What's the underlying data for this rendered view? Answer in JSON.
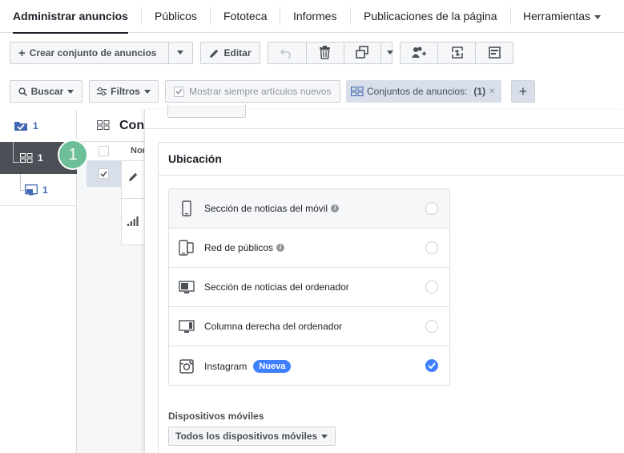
{
  "nav": {
    "tabs": [
      {
        "label": "Administrar anuncios"
      },
      {
        "label": "Públicos"
      },
      {
        "label": "Fototeca"
      },
      {
        "label": "Informes"
      },
      {
        "label": "Publicaciones de la página"
      },
      {
        "label": "Herramientas"
      }
    ]
  },
  "toolbar": {
    "create_label": "Crear conjunto de anuncios",
    "edit_label": "Editar"
  },
  "filters": {
    "search_label": "Buscar",
    "filters_label": "Filtros",
    "show_new_label": "Mostrar siempre artículos nuevos",
    "chip_label": "Conjuntos de anuncios:",
    "chip_count": "(1)",
    "add_label": "+"
  },
  "tree": {
    "campaign_count": "1",
    "adset_count": "1",
    "ad_count": "1"
  },
  "table": {
    "title": "Con",
    "col_header": "Nor"
  },
  "placement": {
    "section_title": "Ubicación",
    "items": [
      {
        "label": "Sección de noticias del móvil",
        "checked": false
      },
      {
        "label": "Red de públicos",
        "checked": false
      },
      {
        "label": "Sección de noticias del ordenador",
        "checked": false
      },
      {
        "label": "Columna derecha del ordenador",
        "checked": false
      },
      {
        "label": "Instagram",
        "badge": "Nueva",
        "checked": true
      }
    ],
    "devices_label": "Dispositivos móviles",
    "devices_value": "Todos los dispositivos móviles"
  },
  "step": "1",
  "colors": {
    "accent": "#4080ff",
    "step": "#6dbf9a",
    "selected_row": "#4b4f56"
  }
}
